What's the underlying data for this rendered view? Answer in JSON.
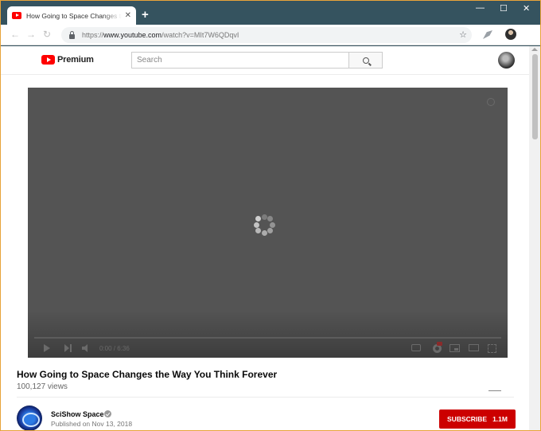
{
  "browser": {
    "tab": {
      "title": "How Going to Space Changes the Way You Think Forever - YouTube",
      "close_glyph": "✕"
    },
    "new_tab_glyph": "+",
    "window_controls": {
      "minimize": "—",
      "maximize": "☐",
      "close": "✕"
    },
    "address": {
      "protocol": "https://",
      "host": "www.youtube.com",
      "path": "/watch?v=MIt7W6QDqvI"
    },
    "icons": {
      "bookmark": "star-icon",
      "extension": "extension-icon",
      "profile": "profile-icon"
    }
  },
  "youtube": {
    "logo_text": "Premium",
    "search": {
      "placeholder": "Search"
    },
    "accent_color": "#ff0000"
  },
  "player": {
    "state": "loading",
    "time_current": "0:00",
    "time_total": "6:36",
    "time_display": "0:00 / 6:36"
  },
  "video": {
    "title": "How Going to Space Changes the Way You Think Forever",
    "views": "100,127 views"
  },
  "channel": {
    "name": "SciShow Space",
    "published": "Published on Nov 13, 2018",
    "subscribe_label": "SUBSCRIBE",
    "subscriber_count": "1.1M",
    "subscribe_color": "#cc0000"
  }
}
